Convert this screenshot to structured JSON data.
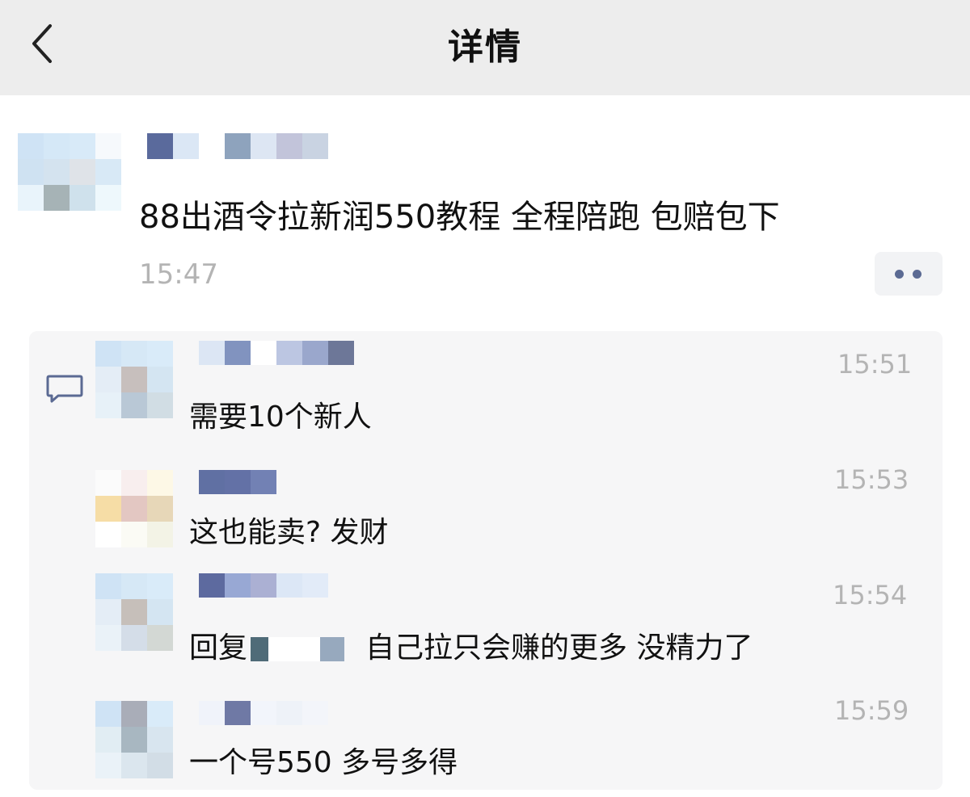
{
  "header": {
    "title": "详情"
  },
  "post": {
    "text": "88出酒令拉新润550教程 全程陪跑 包赔包下",
    "time": "15:47"
  },
  "comments": [
    {
      "time": "15:51",
      "text": "需要10个新人"
    },
    {
      "time": "15:53",
      "text": "这也能卖? 发财"
    },
    {
      "time": "15:54",
      "reply_prefix": "回复",
      "text": "自己拉只会赚的更多 没精力了"
    },
    {
      "time": "15:59",
      "text": "一个号550 多号多得"
    }
  ],
  "colors": {
    "header_bg": "#ededed",
    "comments_bg": "#f6f6f7",
    "time_text": "#b4b4b4",
    "accent": "#5b6a93"
  },
  "icons": {
    "back": "chevron-left-icon",
    "more": "more-dots-icon",
    "comment": "comment-bubble-icon"
  }
}
